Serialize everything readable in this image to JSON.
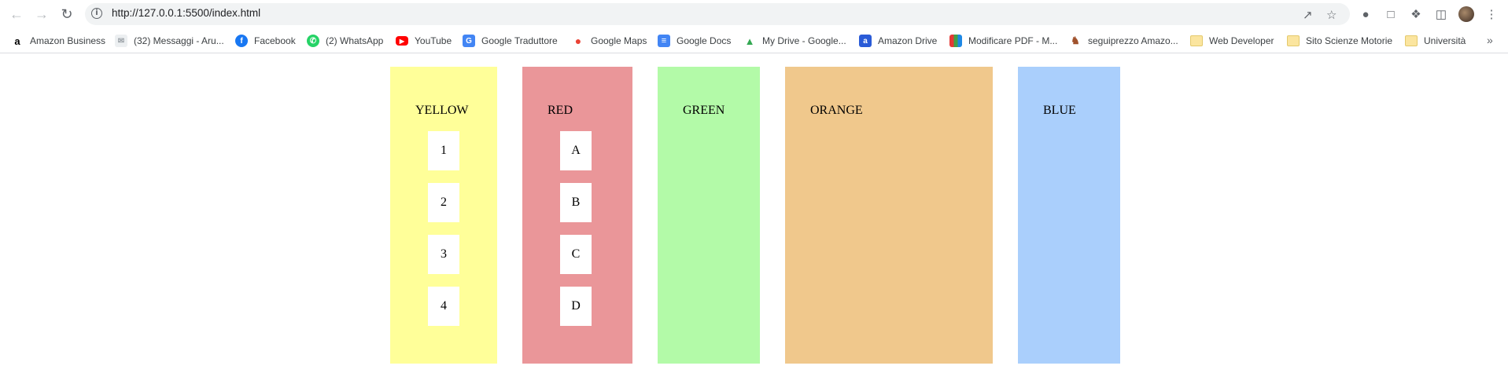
{
  "browser": {
    "url": "http://127.0.0.1:5500/index.html"
  },
  "bookmarks": [
    {
      "label": "Amazon Business",
      "icon": "amazon-icon"
    },
    {
      "label": "(32) Messaggi - Aru...",
      "icon": "aruba-icon"
    },
    {
      "label": "Facebook",
      "icon": "facebook-icon"
    },
    {
      "label": "(2) WhatsApp",
      "icon": "whatsapp-icon"
    },
    {
      "label": "YouTube",
      "icon": "youtube-icon"
    },
    {
      "label": "Google Traduttore",
      "icon": "google-translate-icon"
    },
    {
      "label": "Google Maps",
      "icon": "google-maps-icon"
    },
    {
      "label": "Google Docs",
      "icon": "google-docs-icon"
    },
    {
      "label": "My Drive - Google...",
      "icon": "google-drive-icon"
    },
    {
      "label": "Amazon Drive",
      "icon": "amazon-drive-icon"
    },
    {
      "label": "Modificare PDF - M...",
      "icon": "pdf-icon"
    },
    {
      "label": "seguiprezzo Amazo...",
      "icon": "seguiprezzo-icon"
    },
    {
      "label": "Web Developer",
      "icon": "folder-icon"
    },
    {
      "label": "Sito Scienze Motorie",
      "icon": "folder-icon"
    },
    {
      "label": "Università",
      "icon": "folder-icon"
    }
  ],
  "columns": [
    {
      "title": "YELLOW",
      "color": "#ffff99",
      "items": [
        "1",
        "2",
        "3",
        "4"
      ]
    },
    {
      "title": "RED",
      "color": "#ea9699",
      "items": [
        "A",
        "B",
        "C",
        "D"
      ]
    },
    {
      "title": "GREEN",
      "color": "#b3faa8",
      "items": []
    },
    {
      "title": "ORANGE",
      "color": "#f0c88c",
      "items": []
    },
    {
      "title": "BLUE",
      "color": "#aacffc",
      "items": []
    }
  ]
}
